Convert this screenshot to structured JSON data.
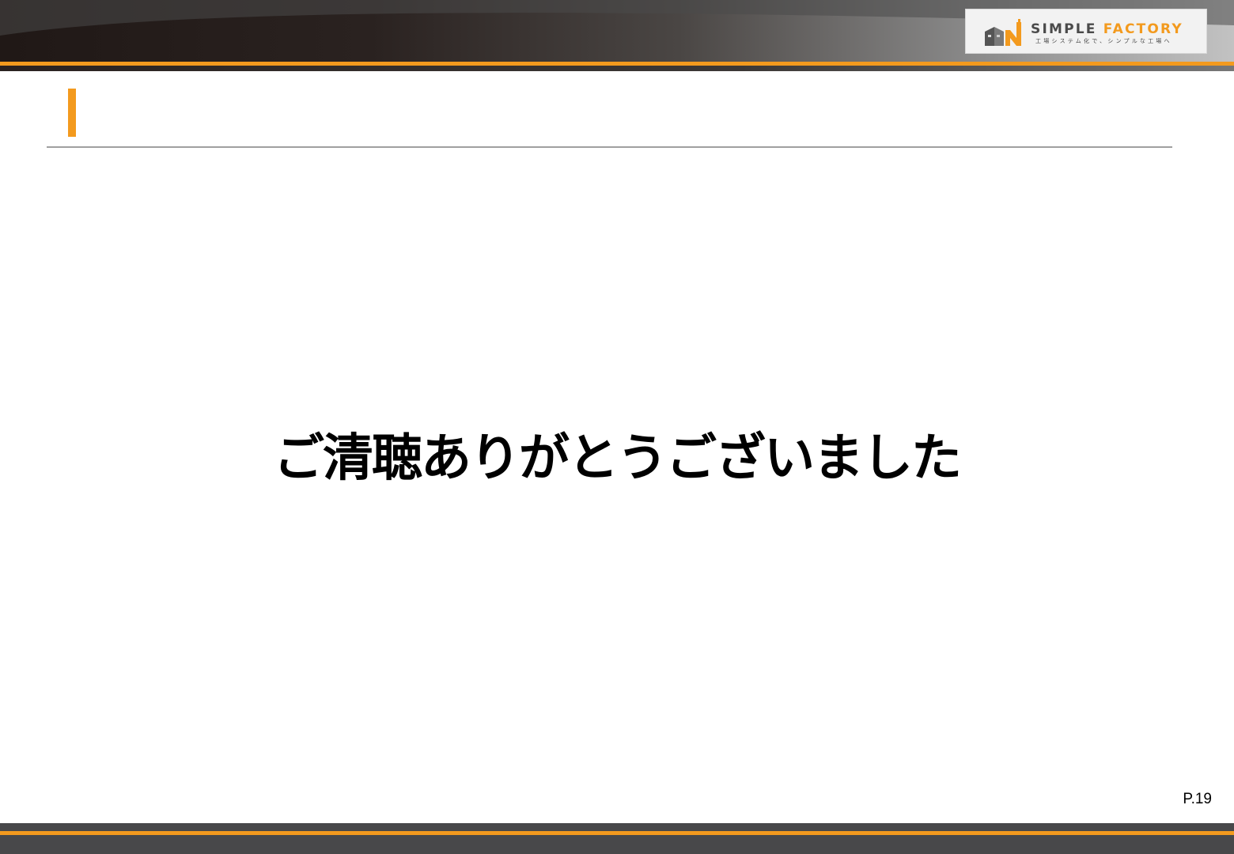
{
  "header": {
    "logo": {
      "name_part1": "SIMPLE",
      "name_part2": "FACTORY",
      "tagline": "工場システム化で、シンプルな工場へ",
      "icon": "factory-icon"
    }
  },
  "slide": {
    "title": "",
    "closing_message": "ご清聴ありがとうございました",
    "page_number": "P.19"
  },
  "colors": {
    "accent": "#f39a1e",
    "dark": "#48484a",
    "rule": "#a0a0a0"
  }
}
